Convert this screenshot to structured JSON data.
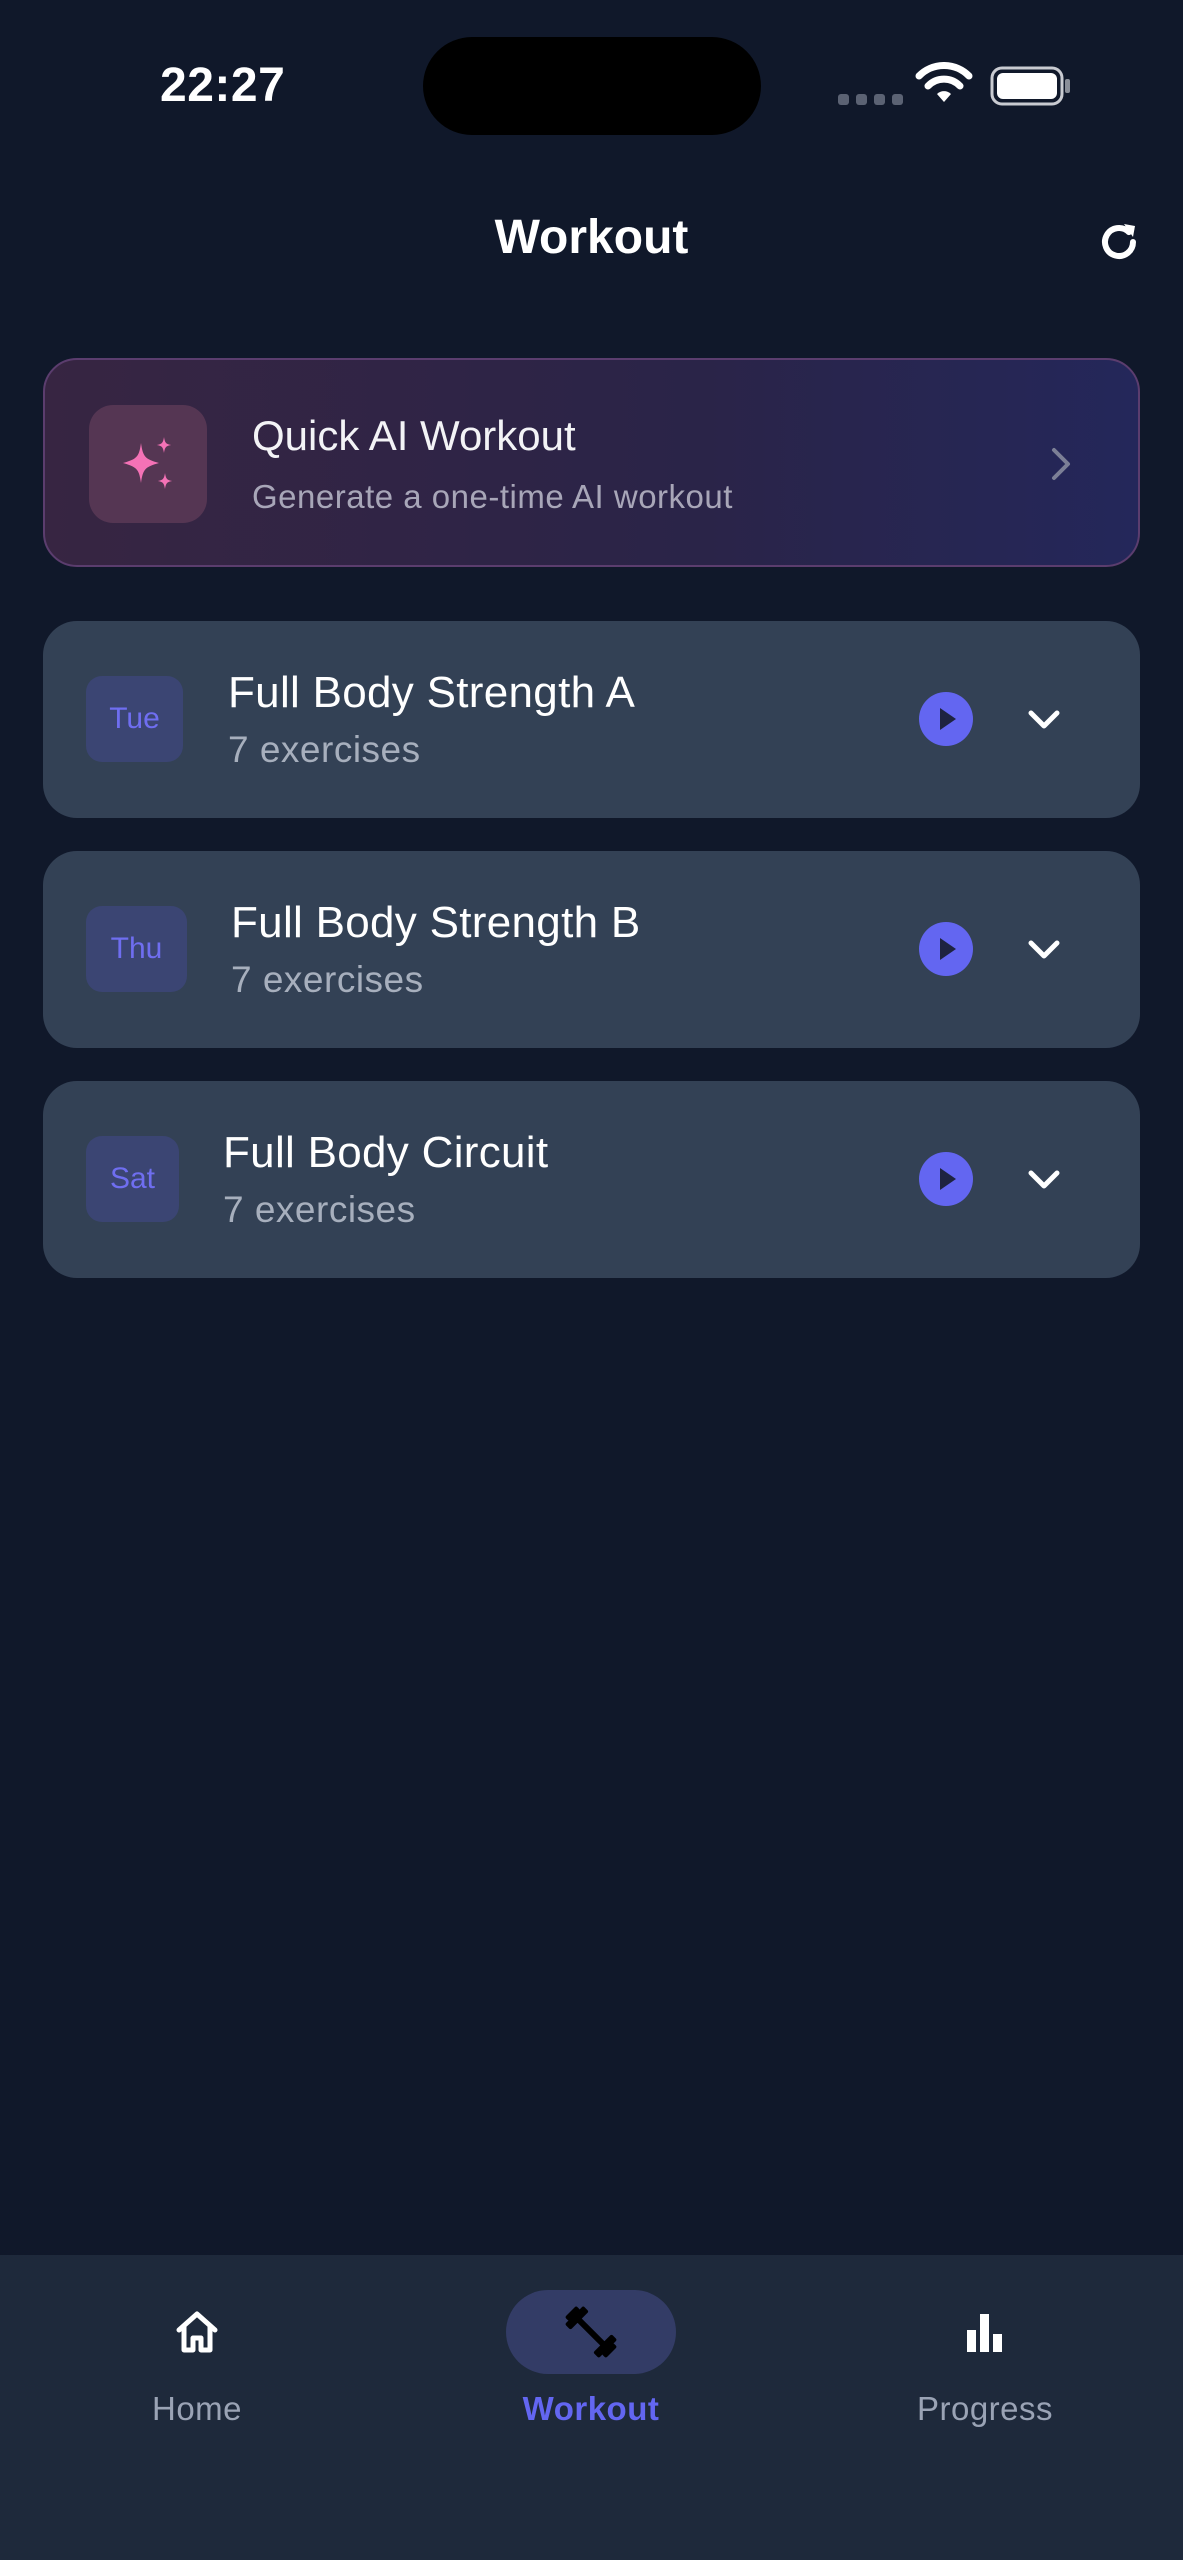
{
  "status_bar": {
    "time": "22:27"
  },
  "header": {
    "title": "Workout",
    "refresh_icon": "refresh-icon"
  },
  "ai_card": {
    "title": "Quick AI Workout",
    "subtitle": "Generate a one-time AI workout",
    "icon": "sparkles-icon",
    "accent": "#f472b6"
  },
  "workouts": [
    {
      "day": "Tue",
      "name": "Full Body Strength A",
      "count": "7 exercises"
    },
    {
      "day": "Thu",
      "name": "Full Body Strength B",
      "count": "7 exercises"
    },
    {
      "day": "Sat",
      "name": "Full Body Circuit",
      "count": "7 exercises"
    }
  ],
  "nav": {
    "items": [
      {
        "label": "Home",
        "icon": "home-icon",
        "active": false
      },
      {
        "label": "Workout",
        "icon": "dumbbell-icon",
        "active": true
      },
      {
        "label": "Progress",
        "icon": "bar-chart-icon",
        "active": false
      }
    ]
  },
  "colors": {
    "background": "#10182a",
    "card": "#334155",
    "accent": "#6366f1",
    "nav_background": "#1e293b"
  }
}
